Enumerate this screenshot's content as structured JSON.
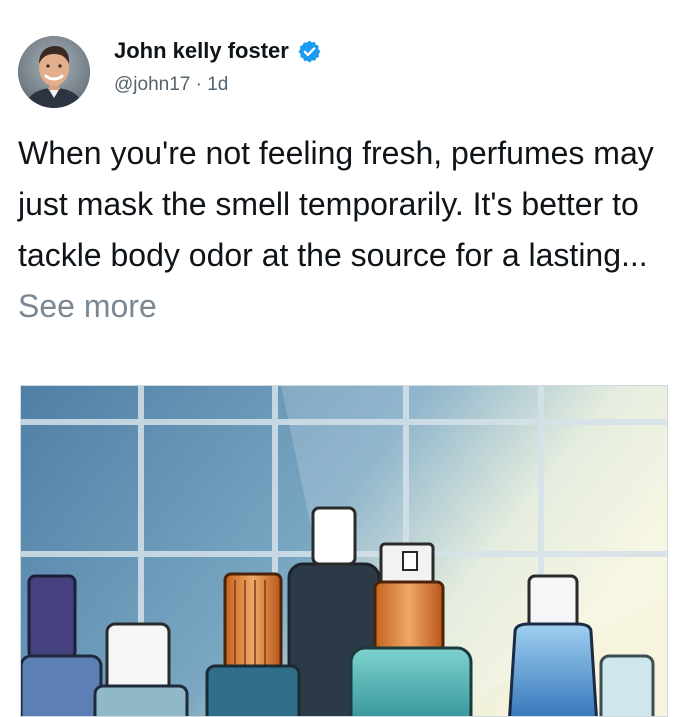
{
  "author": {
    "name": "John kelly foster",
    "handle": "@john17",
    "separator": "·",
    "time": "1d",
    "verified": true
  },
  "tweet": {
    "text": "When you're not feeling fresh, perfumes may just mask the smell temporarily. It's better to tackle body odor at the source for a lasting...",
    "see_more_label": "See more"
  },
  "icons": {
    "verified": "verified-badge-icon"
  },
  "colors": {
    "verified_blue": "#1d9bf0",
    "text": "#0f1419",
    "secondary": "#536471"
  },
  "media": {
    "image_subject": "perfume bottles in front of tiled wall"
  }
}
